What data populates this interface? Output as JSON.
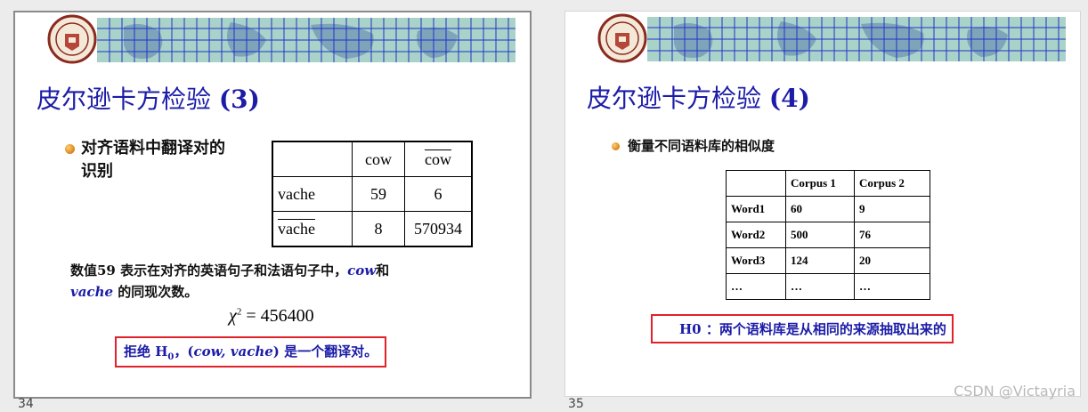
{
  "slides": [
    {
      "title_cn": "皮尔逊卡方检验",
      "title_num": "(3)",
      "bullet_line1": "对齐语料中翻译对的",
      "bullet_line2": "识别",
      "table": {
        "header": [
          "",
          "cow",
          "cow"
        ],
        "rows": [
          [
            "vache",
            "59",
            "6"
          ],
          [
            "vache",
            "8",
            "570934"
          ]
        ]
      },
      "para_part1": "数值59 表示在对齐的英语句子和法语句子中，",
      "para_cow": "cow",
      "para_he": "和",
      "para_vache": "vache",
      "para_part2": " 的同现次数。",
      "formula_lhs": "χ",
      "formula_exp": "2",
      "formula_rhs": "= 456400",
      "reject_pre": "拒绝 H",
      "reject_sub": "0",
      "reject_mid": "，(",
      "reject_it": "cow, vache",
      "reject_post": ") 是一个翻译对。",
      "page_number": "34"
    },
    {
      "title_cn": "皮尔逊卡方检验",
      "title_num": "(4)",
      "bullet": "衡量不同语料库的相似度",
      "table": {
        "header": [
          "",
          "Corpus 1",
          "Corpus 2"
        ],
        "rows": [
          [
            "Word1",
            "60",
            "9"
          ],
          [
            "Word2",
            "500",
            "76"
          ],
          [
            "Word3",
            "124",
            "20"
          ],
          [
            "…",
            "…",
            "…"
          ]
        ]
      },
      "h0": "H0 ：两个语料库是从相同的来源抽取出来的",
      "page_number": "35"
    }
  ],
  "watermark": "CSDN @Victayria",
  "colors": {
    "title": "#1c1ca8",
    "red_box": "#e1222a",
    "banner": "#a9d3c8",
    "grid": "#2233cc"
  }
}
